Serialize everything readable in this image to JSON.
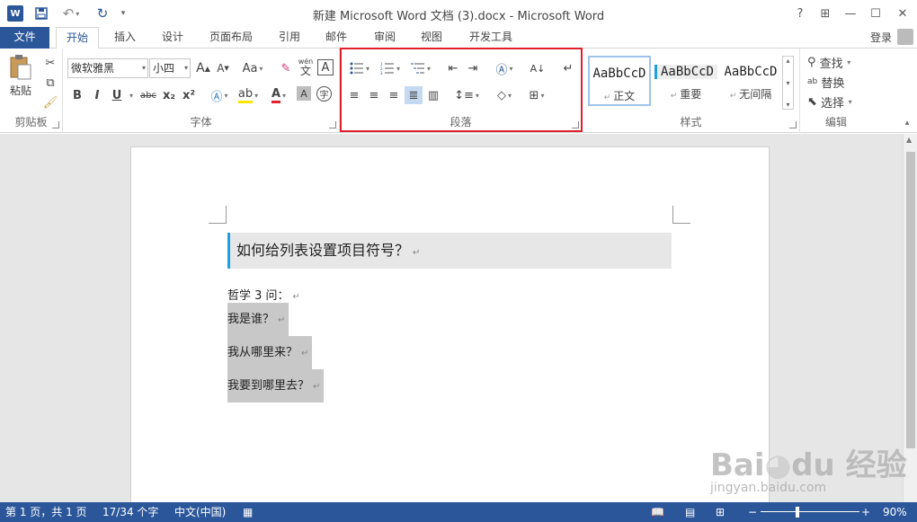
{
  "window": {
    "title": "新建 Microsoft Word 文档 (3).docx - Microsoft Word",
    "app_icon": "W",
    "help": "?",
    "restore_ribbon": "⊞",
    "minimize": "—",
    "maximize": "☐",
    "close": "✕"
  },
  "tabs": {
    "file": "文件",
    "home": "开始",
    "insert": "插入",
    "design": "设计",
    "layout": "页面布局",
    "references": "引用",
    "mailings": "邮件",
    "review": "审阅",
    "view": "视图",
    "developer": "开发工具",
    "signin": "登录"
  },
  "ribbon": {
    "clipboard": {
      "label": "剪贴板",
      "paste": "粘贴"
    },
    "font": {
      "label": "字体",
      "font_name": "微软雅黑",
      "font_size": "小四",
      "bold": "B",
      "italic": "I",
      "underline": "U",
      "strike": "abc",
      "sub": "x₂",
      "sup": "x²",
      "grow": "A",
      "shrink": "A",
      "case": "Aa",
      "phonetic_top": "wén",
      "phonetic_bottom": "文",
      "border": "A"
    },
    "paragraph": {
      "label": "段落"
    },
    "styles": {
      "label": "样式",
      "items": [
        {
          "sample": "AaBbCcD",
          "name": "正文"
        },
        {
          "sample": "AaBbCcD",
          "name": "重要"
        },
        {
          "sample": "AaBbCcD",
          "name": "无间隔"
        }
      ]
    },
    "editing": {
      "label": "编辑",
      "find": "查找",
      "replace": "替换",
      "select": "选择"
    }
  },
  "document": {
    "heading": "如何给列表设置项目符号？",
    "intro": "哲学 3 问：",
    "items": [
      "我是谁？",
      "我从哪里来？",
      "我要到哪里去？"
    ],
    "pilcrow": "↵"
  },
  "status": {
    "page": "第 1 页，共 1 页",
    "words": "17/34 个字",
    "language": "中文(中国)",
    "zoom": "90%",
    "zoom_minus": "−",
    "zoom_plus": "+"
  },
  "colors": {
    "brand": "#2b579a",
    "highlight_box": "#e0202a",
    "heading_accent": "#1ba1e2"
  }
}
